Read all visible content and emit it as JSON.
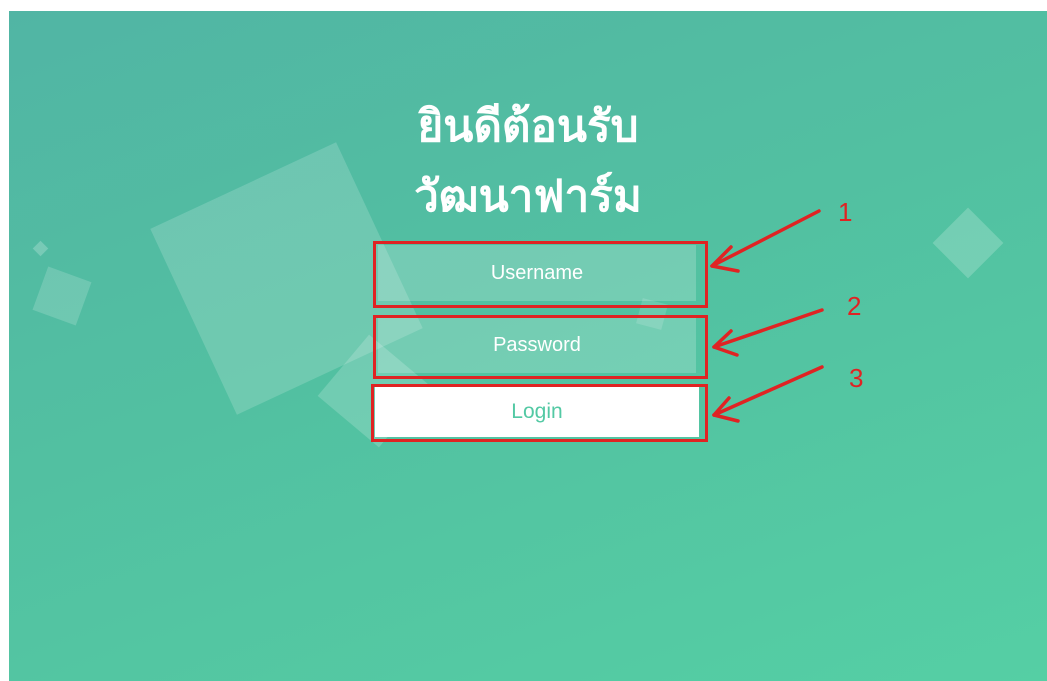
{
  "welcome": {
    "line1": "ยินดีต้อนรับ",
    "line2": "วัฒนาฟาร์ม"
  },
  "form": {
    "username_placeholder": "Username",
    "password_placeholder": "Password",
    "login_label": "Login"
  },
  "annotations": [
    "1",
    "2",
    "3"
  ],
  "colors": {
    "background_start": "#51b5a4",
    "background_end": "#55cfa4",
    "accent": "#53c9a4",
    "annotation": "#e02323"
  }
}
